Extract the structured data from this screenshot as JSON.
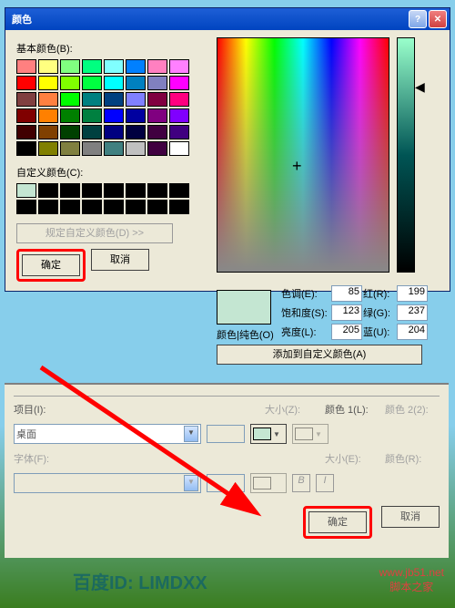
{
  "dialog1": {
    "title": "颜色",
    "basic_label": "基本颜色(B):",
    "custom_label": "自定义颜色(C):",
    "define_custom": "规定自定义颜色(D) >>",
    "ok": "确定",
    "cancel": "取消",
    "color_solid": "颜色|纯色(O)",
    "add_to_custom": "添加到自定义颜色(A)",
    "hue_lbl": "色调(E):",
    "sat_lbl": "饱和度(S):",
    "lum_lbl": "亮度(L):",
    "red_lbl": "红(R):",
    "green_lbl": "绿(G):",
    "blue_lbl": "蓝(U):",
    "hue": "85",
    "sat": "123",
    "lum": "205",
    "red": "199",
    "green": "237",
    "blue": "204",
    "basic_colors": [
      "#FF8080",
      "#FFFF80",
      "#80FF80",
      "#00FF80",
      "#80FFFF",
      "#0080FF",
      "#FF80C0",
      "#FF80FF",
      "#FF0000",
      "#FFFF00",
      "#80FF00",
      "#00FF40",
      "#00FFFF",
      "#0080C0",
      "#8080C0",
      "#FF00FF",
      "#804040",
      "#FF8040",
      "#00FF00",
      "#008080",
      "#004080",
      "#8080FF",
      "#800040",
      "#FF0080",
      "#800000",
      "#FF8000",
      "#008000",
      "#008040",
      "#0000FF",
      "#0000A0",
      "#800080",
      "#8000FF",
      "#400000",
      "#804000",
      "#004000",
      "#004040",
      "#000080",
      "#000040",
      "#400040",
      "#400080",
      "#000000",
      "#808000",
      "#808040",
      "#808080",
      "#408080",
      "#C0C0C0",
      "#400040",
      "#FFFFFF"
    ]
  },
  "dialog2": {
    "item_lbl": "项目(I):",
    "item_value": "桌面",
    "size_lbl": "大小(Z):",
    "color1_lbl": "颜色 1(L):",
    "color2_lbl": "颜色 2(2):",
    "font_lbl": "字体(F):",
    "size2_lbl": "大小(E):",
    "color_lbl": "颜色(R):",
    "ok": "确定",
    "cancel": "取消",
    "btn_b": "B",
    "btn_i": "I"
  },
  "watermark": "百度ID: LIMDXX",
  "site": "www.jb51.net\n脚本之家"
}
